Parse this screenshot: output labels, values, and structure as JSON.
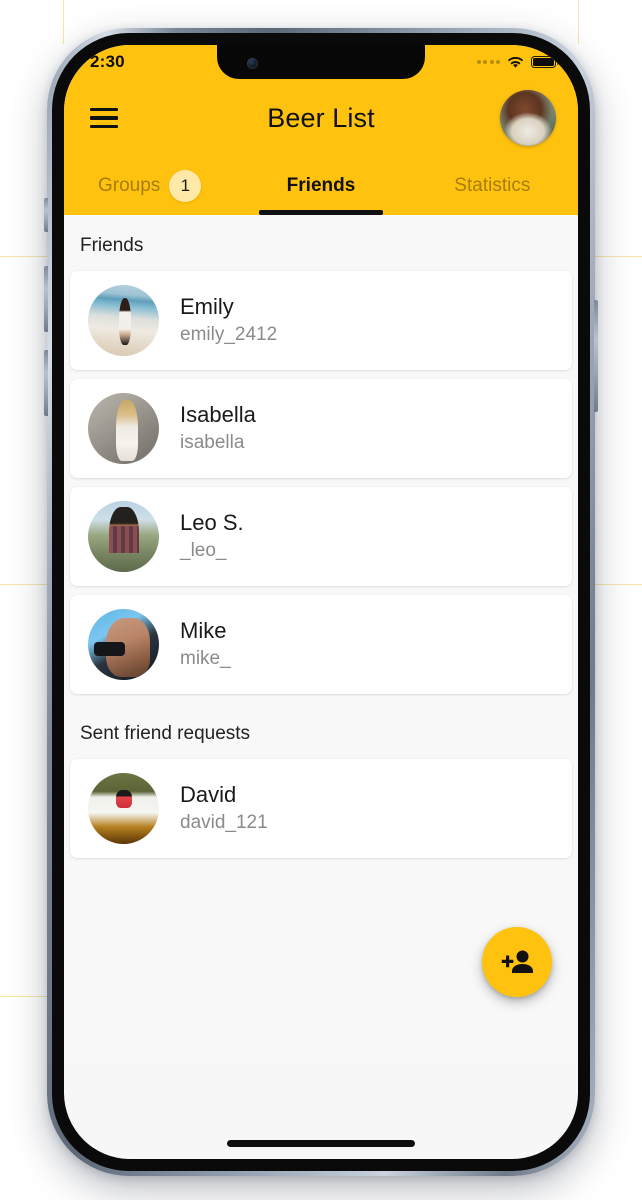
{
  "status_bar": {
    "time": "2:30",
    "signal_icon": "cellular-dots-icon",
    "wifi_icon": "wifi-icon",
    "battery_icon": "battery-full-icon"
  },
  "header": {
    "menu_icon": "hamburger-menu-icon",
    "title": "Beer List",
    "avatar_name": "profile-avatar"
  },
  "tabs": [
    {
      "label": "Groups",
      "badge": "1",
      "active": false
    },
    {
      "label": "Friends",
      "badge": null,
      "active": true
    },
    {
      "label": "Statistics",
      "badge": null,
      "active": false
    }
  ],
  "sections": [
    {
      "header": "Friends",
      "items": [
        {
          "name": "Emily",
          "handle": "emily_2412",
          "avatar": "emily-avatar"
        },
        {
          "name": "Isabella",
          "handle": "isabella",
          "avatar": "isabella-avatar"
        },
        {
          "name": "Leo S.",
          "handle": "_leo_",
          "avatar": "leo-avatar"
        },
        {
          "name": "Mike",
          "handle": "mike_",
          "avatar": "mike-avatar"
        }
      ]
    },
    {
      "header": "Sent friend requests",
      "items": [
        {
          "name": "David",
          "handle": "david_121",
          "avatar": "david-avatar"
        }
      ]
    }
  ],
  "fab": {
    "icon": "person-add-icon",
    "label": "Add friend"
  },
  "colors": {
    "accent_yellow": "#ffc20e",
    "badge_yellow": "#ffe9a8",
    "content_background": "#f8f8f8",
    "card_background": "#ffffff",
    "primary_text": "#1a1a1a",
    "secondary_text": "#8b8b8b",
    "inactive_tab_text": "#9b823a"
  }
}
